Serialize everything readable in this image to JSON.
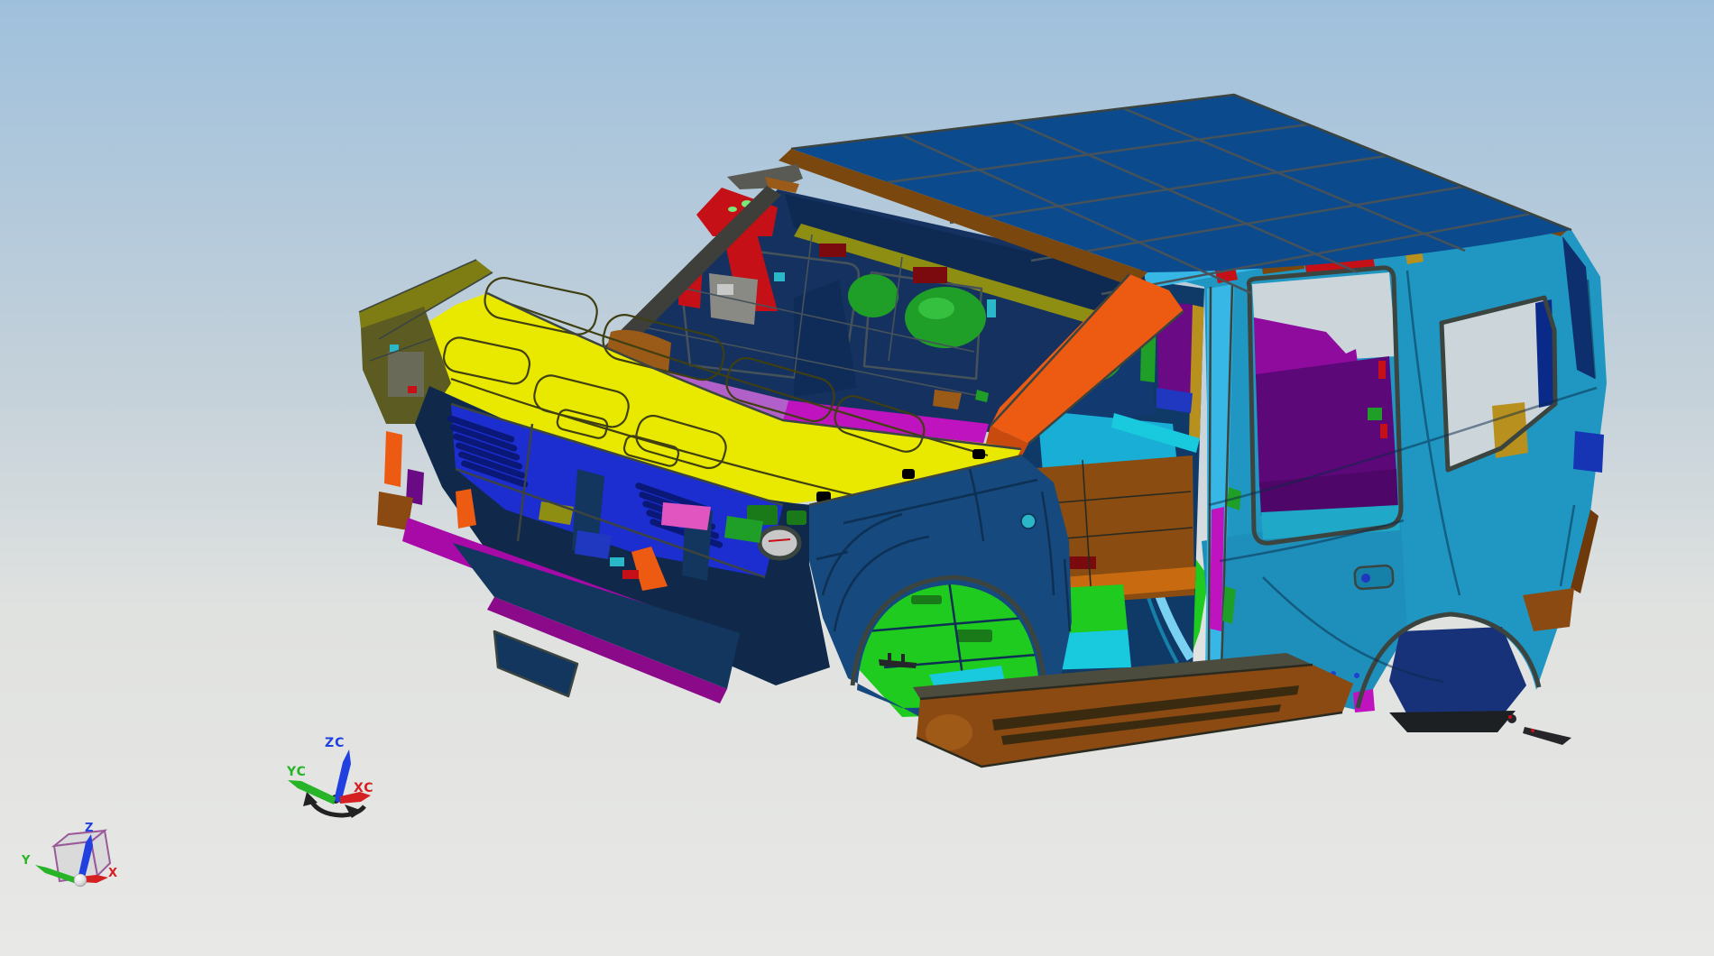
{
  "viewport": {
    "description": "CAD 3D viewport showing a multicolor SUV body-in-white model",
    "background": {
      "top": "#9fc0dc",
      "mid": "#c6d2da",
      "low": "#e0e2e0",
      "bottom": "#e8e8e6"
    }
  },
  "palette": {
    "roof_blue": "#0c4a8e",
    "body_cyan": "#1f97c2",
    "body_cyan_light": "#36b7e6",
    "body_cyan_bright": "#19c9dd",
    "door_skin": "#1e8fba",
    "panel_cyan": "#18aed6",
    "navy": "#16497e",
    "navy_dark": "#10294a",
    "navy_deep": "#12365e",
    "interior_navy": "#14315f",
    "interior_dark": "#0e2a52",
    "wheelhouse_navy": "#18327a",
    "hood_yellow": "#e9e900",
    "olive": "#7d7d14",
    "olive_dark": "#5c5c22",
    "olive_rail": "#8e8e12",
    "gold": "#b8901d",
    "grille_blue": "#1c2ed0",
    "grille_slot": "#0a1878",
    "magenta": "#a80aa8",
    "magenta_bright": "#c013c0",
    "violet": "#b060c8",
    "pink": "#e055c0",
    "purple": "#6a0a85",
    "purple_dark": "#5c0878",
    "purple_deep": "#4e0668",
    "shelf_magenta": "#8e0b9e",
    "orange": "#ed5a12",
    "orange_deep": "#c86a10",
    "brown": "#8a4a12",
    "brown_dark": "#6e3a0c",
    "header_brown": "#7a480e",
    "copper": "#9a5a18",
    "floor_brown": "#8a4c10",
    "red": "#c41016",
    "red_dark": "#7a0a0e",
    "green_bright": "#1ecb1e",
    "green_mid": "#1f9e28",
    "green_dark": "#1a7a1a",
    "green_glyph": "#7ae87a",
    "teal": "#2ab8c8",
    "blue_bright": "#2038c0",
    "blue_royal": "#1535b5",
    "steel": "#8a8a84",
    "silver": "#c8c8c8",
    "gray_rail": "#5a5a54",
    "apillar_gray": "#3e3e3a",
    "shadow": "#1c2022",
    "dark_part": "#26262a",
    "window_bg": "#cbd5da",
    "slab_top": "#4c4c3e",
    "slab_stripe": "#3a2a10",
    "cap_light": "#a05a18"
  },
  "wcs_triad": {
    "z_label": "ZC",
    "y_label": "YC",
    "x_label": "XC",
    "z_color": "#2040e0",
    "y_color": "#28b428",
    "x_color": "#d42020",
    "handle_color": "#222222"
  },
  "view_triad": {
    "z_label": "Z",
    "y_label": "Y",
    "x_label": "X",
    "z_color": "#2040e0",
    "y_color": "#28b428",
    "x_color": "#d42020",
    "cube_edge": "#9a5a9a",
    "cube_face": "rgba(205,205,210,0.5)"
  }
}
